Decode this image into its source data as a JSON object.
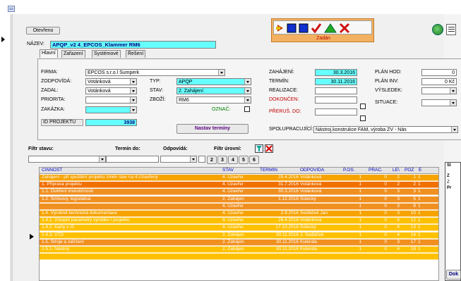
{
  "window": {
    "title_icon": "form-icon"
  },
  "header": {
    "stav_button": "Otevřeno",
    "nazev_label": "NÁZEV:",
    "nazev_value": "APQP_v2 4_EPCOS_Klammer RM6",
    "status": "Zadán"
  },
  "tabs": [
    "Hlavní",
    "Zařazení",
    "Systémové",
    "Řešení"
  ],
  "form": {
    "firma_label": "FIRMA:",
    "firma_value": "EPCOS s.r.o.l Šumperk",
    "zodpovida_label": "ZODPOVÍDÁ:",
    "zodpovida_value": "Votánková",
    "zadal_label": "ZADAL:",
    "zadal_value": "Votánková",
    "priorita_label": "PRIORITA:",
    "priorita_value": "",
    "zakazka_label": "ZAKÁZKA:",
    "zakazka_value": "",
    "id_label": "ID PROJEKTU",
    "id_value": "3938",
    "typ_label": "TYP:",
    "typ_value": "APQP",
    "stav_label": "STAV:",
    "stav_value": "2. Zahájení",
    "zbozi_label": "ZBOŽÍ:",
    "zbozi_value": "RM6",
    "oznac_label": "OZNAČ:",
    "nastav_button": "Nastav termíny",
    "zahajeni_label": "ZAHÁJENÍ:",
    "zahajeni_value": "30.3.2016",
    "termin_label": "TERMÍN:",
    "termin_value": "30.11.2016",
    "realizace_label": "REALIZACE:",
    "realizace_value": "",
    "dokonceni_label": "DOKONČEN:",
    "dokonceni_value": "",
    "preruseni_label": "PŘERUŠ. DO:",
    "preruseni_value": "",
    "plan_hod_label": "PLÁN HOD:",
    "plan_hod_value": "0",
    "plan_inv_label": "PLÁN INV:",
    "plan_inv_value": "0 Kč",
    "vysledek_label": "VÝSLEDEK:",
    "vysledek_value": "",
    "situace_label": "SITUACE:",
    "situace_value": "",
    "spolu_label": "SPOLUPRACUJÍCÍ:",
    "spolu_value": "Nástroj.konstrukce FAM, výroba ZV - Nás"
  },
  "filters": {
    "stav_label": "Filtr stavu:",
    "termin_label": "Termín do:",
    "odpovida_label": "Odpovídá:",
    "uroven_label": "Filtr úrovní:",
    "levels": [
      "2",
      "3",
      "4",
      "5",
      "6"
    ]
  },
  "grid": {
    "headers": [
      "ČINNOST",
      "STAV",
      "TERMÍN",
      "ODPOVÍDÁ",
      "P.OS.",
      "PRAC.",
      "LE\\",
      "POZ",
      "E"
    ],
    "rows": [
      {
        "cinnost": "Zahájení - při spuštění projektu změn stav na 4.Uzavřený",
        "stav": "4. Uzavřer",
        "termin": "25.4.2016",
        "odpovida": "Votánková",
        "pos": "1",
        "prac": "0",
        "le": "2",
        "poz": "1",
        "e": "1",
        "color": "#f6a300"
      },
      {
        "cinnost": "1. Příprava projektu",
        "stav": "4. Uzavřer",
        "termin": "31.7.2016",
        "odpovida": "Votánková",
        "pos": "1",
        "prac": "0",
        "le": "2",
        "poz": "2",
        "e": "1",
        "color": "#f07000"
      },
      {
        "cinnost": "1.1. Ověření investičnosti",
        "stav": "4. Uzavřer",
        "termin": "30.3.2016",
        "odpovida": "Votánková",
        "pos": "1",
        "prac": "0",
        "le": "3",
        "poz": "3",
        "e": "1",
        "color": "#f09020"
      },
      {
        "cinnost": "1.2. Smlouvy, legislativa",
        "stav": "2. Zahájen",
        "termin": "1.12.2016",
        "odpovida": "Solecký",
        "pos": "1",
        "prac": "0",
        "le": "3",
        "poz": "5",
        "e": "1",
        "color": "#f09020"
      },
      {
        "cinnost": "",
        "stav": "4. Uzavřer",
        "termin": "",
        "odpovida": "",
        "pos": "1",
        "prac": "0",
        "le": "3",
        "poz": "8",
        "e": "1",
        "color": "#f09020"
      },
      {
        "cinnost": "1.4. Výrobně technická dokumentace",
        "stav": "4. Uzavřer",
        "termin": "2.9.2016",
        "odpovida": "Sedláček Jan",
        "pos": "1",
        "prac": "0",
        "le": "3",
        "poz": "10",
        "e": "1",
        "color": "#f6a300"
      },
      {
        "cinnost": "1.4.1. Vstupní parametry výrobku / projektu",
        "stav": "4. Uzavřer",
        "termin": "26.4.2016",
        "odpovida": "Votánková",
        "pos": "1",
        "prac": "0",
        "le": "4",
        "poz": "12",
        "e": "1",
        "color": "#ffc000"
      },
      {
        "cinnost": "1.4.2. Karty v IS",
        "stav": "4. Uzavřer",
        "termin": "17.10.2016",
        "odpovida": "Solecký",
        "pos": "1",
        "prac": "0",
        "le": "4",
        "poz": "13",
        "e": "1",
        "color": "#ffc000"
      },
      {
        "cinnost": "1.4.3. VTD",
        "stav": "2. Zahájen",
        "termin": "30.11.2016",
        "odpovida": "J. Sedláček",
        "pos": "1",
        "prac": "0",
        "le": "4",
        "poz": "14",
        "e": "1",
        "color": "#ffc000"
      },
      {
        "cinnost": "1.5. Stroje a zařízení",
        "stav": "2. Zahájen",
        "termin": "30.11.2016",
        "odpovida": "Kulenda",
        "pos": "1",
        "prac": "0",
        "le": "3",
        "poz": "17",
        "e": "1",
        "color": "#f09020"
      },
      {
        "cinnost": "1.5.1. Nástroj",
        "stav": "2. Zahájen",
        "termin": "30.11.2016",
        "odpovida": "Kulenda",
        "pos": "1",
        "prac": "0",
        "le": "4",
        "poz": "18",
        "e": "1",
        "color": "#ffc000"
      },
      {
        "cinnost": "",
        "stav": "",
        "termin": "",
        "odpovida": "",
        "pos": "",
        "prac": "",
        "le": "",
        "poz": "",
        "e": "",
        "color": "#ffc000"
      }
    ]
  },
  "sidepanel": {
    "line1": "SI",
    "line2": "Z",
    "line3": "Z",
    "line4": "Pr",
    "button": "Dok"
  }
}
